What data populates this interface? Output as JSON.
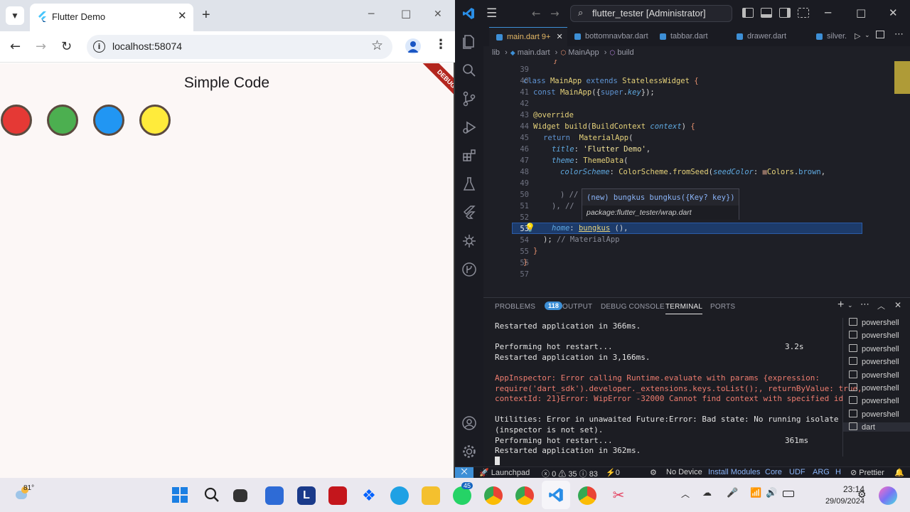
{
  "browser": {
    "tab_title": "Flutter Demo",
    "url": "localhost:58074",
    "window_buttons": {
      "minimize": "─",
      "maximize": "□",
      "close": "✕"
    }
  },
  "app": {
    "title": "Simple Code",
    "debug_banner": "DEBUG",
    "circle_colors": [
      "#e53935",
      "#4caf50",
      "#2196f3",
      "#ffeb3b"
    ]
  },
  "vscode": {
    "command_center": "flutter_tester [Administrator]",
    "tabs": [
      "main.dart 9+",
      "bottomnavbar.dart",
      "tabbar.dart",
      "drawer.dart",
      "silver."
    ],
    "breadcrumb": [
      "lib",
      "main.dart",
      "MainApp",
      "build"
    ],
    "line_numbers": [
      "39",
      "40",
      "41",
      "42",
      "43",
      "44",
      "45",
      "46",
      "47",
      "48",
      "49",
      "50",
      "51",
      "52",
      "53",
      "54",
      "55",
      "56",
      "57"
    ],
    "hover_signature": "(new) bungkus bungkus({Key? key})",
    "hover_package": "package:flutter_tester/wrap.dart",
    "panel_tabs": {
      "problems": "PROBLEMS",
      "problems_count": "118",
      "output": "OUTPUT",
      "debug_console": "DEBUG CONSOLE",
      "terminal": "TERMINAL",
      "ports": "PORTS"
    },
    "terminal_lines": [
      {
        "text": "Restarted application in 366ms.",
        "time": "",
        "error": false
      },
      {
        "text": "",
        "time": "",
        "error": false
      },
      {
        "text": "Performing hot restart...",
        "time": "3.2s",
        "error": false
      },
      {
        "text": "Restarted application in 3,166ms.",
        "time": "",
        "error": false
      },
      {
        "text": "",
        "time": "",
        "error": false
      },
      {
        "text": "AppInspector: Error calling Runtime.evaluate with params {expression:",
        "time": "",
        "error": true
      },
      {
        "text": "require('dart_sdk').developer._extensions.keys.toList();, returnByValue: true,",
        "time": "",
        "error": true
      },
      {
        "text": "contextId: 21}Error: WipError -32000 Cannot find context with specified id",
        "time": "",
        "error": true
      },
      {
        "text": "",
        "time": "",
        "error": false
      },
      {
        "text": "Utilities: Error in unawaited Future:Error: Bad state: No running isolate",
        "time": "",
        "error": false
      },
      {
        "text": "(inspector is not set).",
        "time": "",
        "error": false
      },
      {
        "text": "Performing hot restart...",
        "time": "361ms",
        "error": false
      },
      {
        "text": "Restarted application in 362ms.",
        "time": "",
        "error": false
      }
    ],
    "terminal_list": [
      "powershell",
      "powershell",
      "powershell",
      "powershell",
      "powershell",
      "powershell",
      "powershell",
      "powershell",
      "dart"
    ],
    "status": {
      "launchpad": "Launchpad",
      "errors": "0",
      "warnings": "35",
      "info": "83",
      "ports": "0",
      "device": "No Device",
      "install_modules": "Install Modules",
      "core": "Core",
      "udf": "UDF",
      "arg": "ARG",
      "h": "H",
      "prettier": "Prettier"
    }
  },
  "taskbar": {
    "weather": "81°",
    "whatsapp_badge": "45",
    "time": "23:14",
    "date": "29/09/2024"
  }
}
